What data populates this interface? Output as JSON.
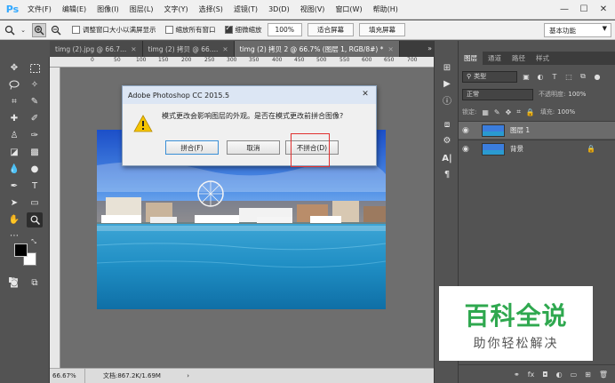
{
  "app": {
    "logo": "Ps"
  },
  "menu": [
    "文件(F)",
    "编辑(E)",
    "图像(I)",
    "图层(L)",
    "文字(Y)",
    "选择(S)",
    "滤镜(T)",
    "3D(D)",
    "视图(V)",
    "窗口(W)",
    "帮助(H)"
  ],
  "window_controls": {
    "minimize": "—",
    "maximize": "☐",
    "close": "✕"
  },
  "options": {
    "resize_windows": "调整窗口大小以满屏显示",
    "zoom_all": "缩放所有窗口",
    "scrubby_zoom": "细微缩放",
    "zoom_value": "100%",
    "fit_screen": "适合屏幕",
    "fill_screen": "填充屏幕",
    "workspace": "基本功能"
  },
  "tabs": [
    {
      "label": "timg (2).jpg @ 66.7...",
      "active": false
    },
    {
      "label": "timg (2) 拷贝 @ 66....",
      "active": false
    },
    {
      "label": "timg (2) 拷贝 2 @ 66.7% (图层 1, RGB/8#) *",
      "active": true
    }
  ],
  "ruler_ticks": [
    "0",
    "50",
    "100",
    "150",
    "200",
    "250",
    "300",
    "350",
    "400",
    "450",
    "500",
    "550",
    "600",
    "650",
    "700"
  ],
  "status": {
    "zoom": "66.67%",
    "doc": "文档:867.2K/1.69M"
  },
  "dialog": {
    "title": "Adobe Photoshop CC 2015.5",
    "message": "模式更改会影响图层的外观。是否在模式更改前拼合图像?",
    "flatten": "拼合(F)",
    "cancel": "取消",
    "dont_flatten": "不拼合(D)"
  },
  "panel": {
    "tabs": [
      "图层",
      "通道",
      "路径",
      "样式"
    ],
    "filter_kind": "类型",
    "blend_mode": "正常",
    "opacity_label": "不透明度:",
    "opacity": "100%",
    "lock_label": "锁定:",
    "fill_label": "填充:",
    "fill": "100%",
    "layers": [
      {
        "name": "图层 1",
        "selected": true,
        "locked": false
      },
      {
        "name": "背景",
        "selected": false,
        "locked": true
      }
    ]
  },
  "watermark": {
    "main": "百科全说",
    "sub": "助你轻松解决"
  }
}
